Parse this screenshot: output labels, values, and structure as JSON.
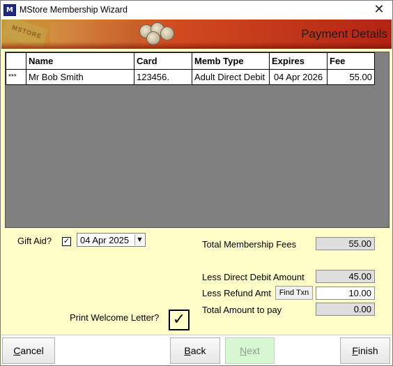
{
  "window": {
    "title": "MStore Membership Wizard",
    "icon_text": "M",
    "close_glyph": "✕"
  },
  "banner": {
    "title": "Payment Details",
    "logo_text": "MSTORE"
  },
  "table": {
    "columns": [
      "",
      "Name",
      "Card",
      "Memb Type",
      "Expires",
      "Fee"
    ],
    "rows": [
      {
        "marker": "***",
        "name": "Mr Bob Smith",
        "card": "123456.",
        "type": "Adult Direct Debit",
        "expires": "04 Apr 2026",
        "fee": "55.00"
      }
    ]
  },
  "gift_aid": {
    "label": "Gift Aid?",
    "checked": true,
    "check_glyph": "✓",
    "date_value": "04  Apr  2025",
    "dropdown_glyph": "▼"
  },
  "totals": {
    "membership_fees_label": "Total Membership Fees",
    "membership_fees_value": "55.00",
    "direct_debit_label": "Less Direct Debit Amount",
    "direct_debit_value": "45.00",
    "refund_label": "Less Refund Amt",
    "find_txn_label": "Find Txn",
    "refund_value": "10.00",
    "amount_to_pay_label": "Total Amount to pay",
    "amount_to_pay_value": "0.00"
  },
  "welcome_letter": {
    "label": "Print Welcome Letter?",
    "checked": true,
    "check_glyph": "✓"
  },
  "buttons": {
    "cancel": {
      "mnemonic": "C",
      "rest": "ancel",
      "enabled": true
    },
    "back": {
      "mnemonic": "B",
      "rest": "ack",
      "enabled": true
    },
    "next": {
      "mnemonic": "N",
      "rest": "ext",
      "enabled": false
    },
    "finish": {
      "mnemonic": "F",
      "rest": "inish",
      "enabled": true
    }
  }
}
